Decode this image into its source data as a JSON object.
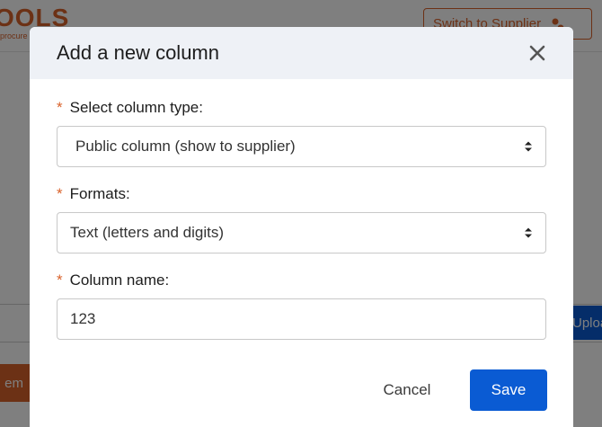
{
  "background": {
    "logo_text": "OOLS",
    "logo_sub": "procure",
    "switch_button_label": "Switch to Supplier",
    "upload_button_label": "Uploa",
    "item_button_label": "em"
  },
  "modal": {
    "title": "Add a new column",
    "close_icon": "close-icon",
    "fields": {
      "column_type": {
        "required_mark": "*",
        "label": "Select column type:",
        "value": "Public column (show to supplier)"
      },
      "formats": {
        "required_mark": "*",
        "label": "Formats:",
        "value": "Text (letters and digits)"
      },
      "column_name": {
        "required_mark": "*",
        "label": "Column name:",
        "value": "123"
      }
    },
    "cancel_label": "Cancel",
    "save_label": "Save"
  },
  "colors": {
    "accent": "#d9622b",
    "primary": "#0a5bd3",
    "header_bg": "#eef1f6"
  }
}
